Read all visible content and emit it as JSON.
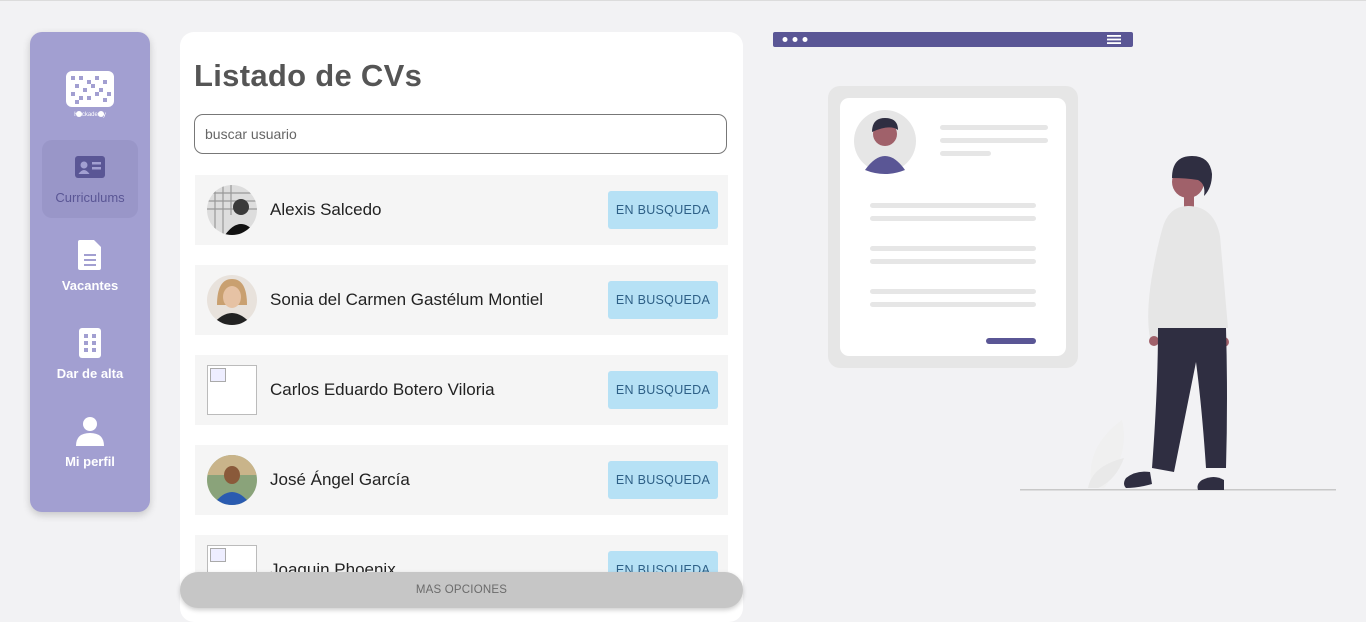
{
  "sidebar": {
    "logo_text": "Hackademy",
    "items": [
      {
        "label": "Curriculums",
        "icon": "id-card-icon",
        "active": true
      },
      {
        "label": "Vacantes",
        "icon": "document-icon",
        "active": false
      },
      {
        "label": "Dar de alta",
        "icon": "building-icon",
        "active": false
      },
      {
        "label": "Mi perfil",
        "icon": "user-icon",
        "active": false
      }
    ]
  },
  "main": {
    "title": "Listado de CVs",
    "search": {
      "value": "",
      "placeholder": "buscar usuario"
    },
    "candidates": [
      {
        "name": "Alexis Salcedo",
        "status": "EN BUSQUEDA"
      },
      {
        "name": "Sonia del Carmen Gastélum Montiel",
        "status": "EN BUSQUEDA"
      },
      {
        "name": "Carlos Eduardo Botero Viloria",
        "status": "EN BUSQUEDA"
      },
      {
        "name": "José Ángel García",
        "status": "EN BUSQUEDA"
      },
      {
        "name": "Joaquin Phoenix",
        "status": "EN BUSQUEDA"
      }
    ],
    "more_options": "MAS OPCIONES"
  },
  "colors": {
    "sidebar": "#a29fd1",
    "accent": "#5a5695",
    "badge": "#b6e1f5",
    "background": "#f2f2f4"
  }
}
